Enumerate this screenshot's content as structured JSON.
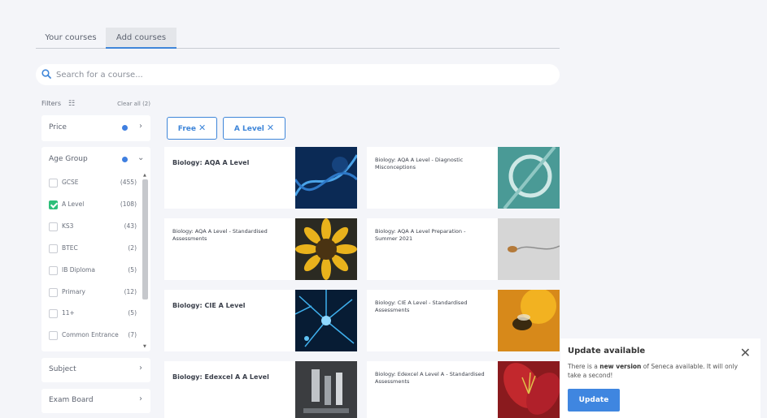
{
  "tabs": [
    {
      "label": "Your courses",
      "active": false
    },
    {
      "label": "Add courses",
      "active": true
    }
  ],
  "search": {
    "placeholder": "Search for a course..."
  },
  "filters": {
    "label": "Filters",
    "clear_label": "Clear all (2)",
    "price": {
      "title": "Price"
    },
    "age_group": {
      "title": "Age Group",
      "options": [
        {
          "name": "GCSE",
          "count": "(455)",
          "checked": false
        },
        {
          "name": "A Level",
          "count": "(108)",
          "checked": true
        },
        {
          "name": "KS3",
          "count": "(43)",
          "checked": false
        },
        {
          "name": "BTEC",
          "count": "(2)",
          "checked": false
        },
        {
          "name": "IB Diploma",
          "count": "(5)",
          "checked": false
        },
        {
          "name": "Primary",
          "count": "(12)",
          "checked": false
        },
        {
          "name": "11+",
          "count": "(5)",
          "checked": false
        },
        {
          "name": "Common Entrance",
          "count": "(7)",
          "checked": false
        }
      ]
    },
    "subject": {
      "title": "Subject"
    },
    "exam_board": {
      "title": "Exam Board"
    }
  },
  "active_chips": [
    {
      "label": "Free"
    },
    {
      "label": "A Level"
    }
  ],
  "courses": [
    {
      "title": "Biology: AQA A Level"
    },
    {
      "title": "Biology: AQA A Level - Diagnostic Misconceptions"
    },
    {
      "title": "Biology: AQA A Level - Standardised Assessments"
    },
    {
      "title": "Biology: AQA A Level Preparation - Summer 2021"
    },
    {
      "title": "Biology: CIE A Level"
    },
    {
      "title": "Biology: CIE A Level - Standardised Assessments"
    },
    {
      "title": "Biology: Edexcel A A Level"
    },
    {
      "title": "Biology: Edexcel A Level A - Standardised Assessments"
    }
  ],
  "toast": {
    "title": "Update available",
    "message_pre": "There is a",
    "message_bold": "new version",
    "message_post": "of Seneca available. It will only take a second!",
    "button": "Update"
  },
  "colors": {
    "accent": "#3f86d9",
    "check": "#2ebf7a",
    "dot": "#3f7fe0"
  }
}
